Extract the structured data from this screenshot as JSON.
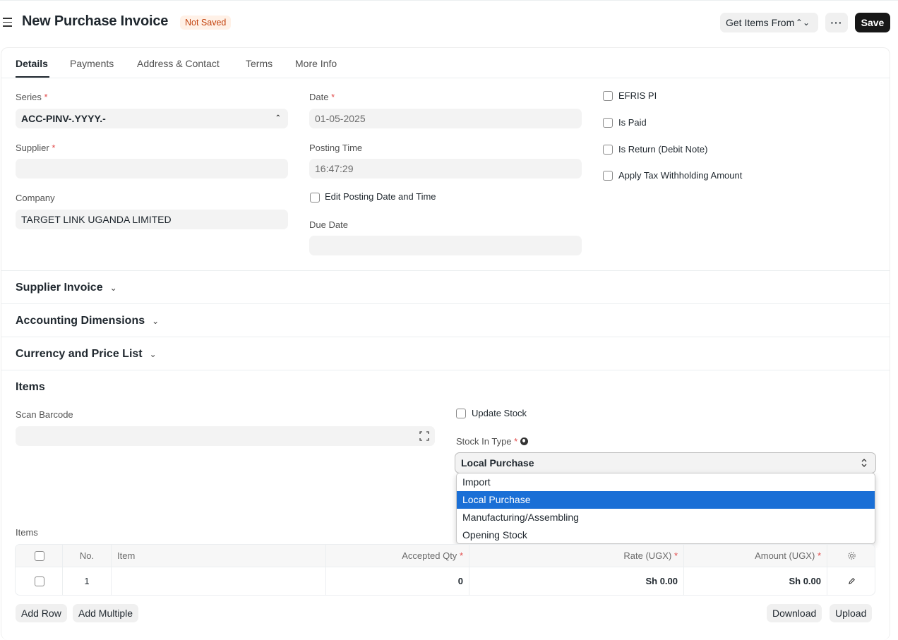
{
  "header": {
    "title": "New Purchase Invoice",
    "status": "Not Saved",
    "get_items_label": "Get Items From",
    "more_label": "···",
    "save_label": "Save"
  },
  "tabs": [
    "Details",
    "Payments",
    "Address & Contact",
    "Terms",
    "More Info"
  ],
  "details": {
    "series_label": "Series",
    "series_value": "ACC-PINV-.YYYY.-",
    "supplier_label": "Supplier",
    "supplier_value": "",
    "company_label": "Company",
    "company_value": "TARGET LINK UGANDA LIMITED",
    "date_label": "Date",
    "date_value": "01-05-2025",
    "posting_time_label": "Posting Time",
    "posting_time_value": "16:47:29",
    "edit_posting_label": "Edit Posting Date and Time",
    "due_date_label": "Due Date",
    "due_date_value": "",
    "checkboxes": [
      "EFRIS PI",
      "Is Paid",
      "Is Return (Debit Note)",
      "Apply Tax Withholding Amount"
    ]
  },
  "sections": [
    "Supplier Invoice",
    "Accounting Dimensions",
    "Currency and Price List"
  ],
  "items_section": {
    "title": "Items",
    "scan_barcode_label": "Scan Barcode",
    "update_stock_label": "Update Stock",
    "stock_in_type_label": "Stock In Type",
    "stock_in_type_value": "Local Purchase",
    "stock_in_type_options": [
      "Import",
      "Local Purchase",
      "Manufacturing/Assembling",
      "Opening Stock"
    ],
    "items_label": "Items",
    "table_headers": {
      "no": "No.",
      "item": "Item",
      "accepted_qty": "Accepted Qty",
      "rate": "Rate (UGX)",
      "amount": "Amount (UGX)"
    },
    "rows": [
      {
        "no": "1",
        "item": "",
        "accepted_qty": "0",
        "rate": "Sh 0.00",
        "amount": "Sh 0.00"
      }
    ],
    "add_row_label": "Add Row",
    "add_multiple_label": "Add Multiple",
    "download_label": "Download",
    "upload_label": "Upload"
  },
  "colors": {
    "accent": "#1a6fd6",
    "status_bg": "#fff1e7",
    "status_text": "#c2410c",
    "primary_button": "#171717",
    "required": "#e24c4c"
  }
}
